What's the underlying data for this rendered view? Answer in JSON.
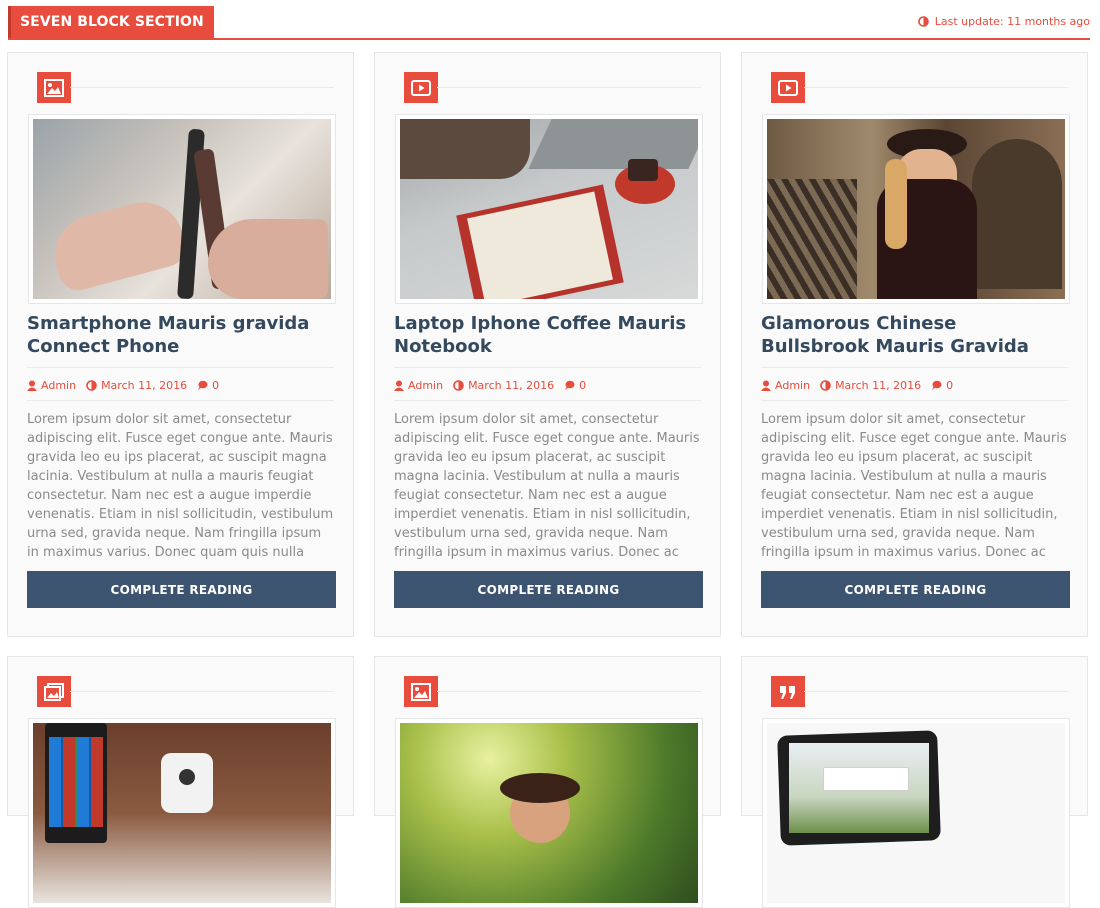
{
  "section": {
    "title": "SEVEN BLOCK SECTION",
    "last_update": "Last update: 11 months ago"
  },
  "colors": {
    "accent": "#e74c3c",
    "button": "#3d5470",
    "title": "#34495e"
  },
  "posts": [
    {
      "format_icon": "image-icon",
      "title": "Smartphone Mauris gravida Connect Phone",
      "author": "Admin",
      "date": "March 11, 2016",
      "comments": "0",
      "excerpt": "Lorem ipsum dolor sit amet, consectetur adipiscing elit.  Fusce eget congue ante.  Mauris gravida leo eu ips placerat, ac suscipit magna lacinia. Vestibulum at nulla a mauris feugiat consectetur. Nam nec est a augue imperdie venenatis. Etiam in nisl sollicitudin, vestibulum urna sed, gravida neque. Nam fringilla ipsum in maximus varius. Donec  quam quis nulla",
      "button": "COMPLETE READING"
    },
    {
      "format_icon": "video-icon",
      "title": "Laptop Iphone Coffee Mauris Notebook",
      "author": "Admin",
      "date": "March 11, 2016",
      "comments": "0",
      "excerpt": "Lorem ipsum dolor sit amet, consectetur adipiscing elit. Fusce eget congue ante. Mauris gravida leo eu ipsum placerat, ac suscipit magna lacinia. Vestibulum at nulla a mauris feugiat consectetur. Nam nec est a augue imperdiet venenatis. Etiam in nisl sollicitudin, vestibulum urna sed, gravida neque. Nam fringilla ipsum in maximus varius. Donec ac quam quis",
      "button": "COMPLETE READING"
    },
    {
      "format_icon": "video-icon",
      "title": "Glamorous Chinese Bullsbrook Mauris Gravida",
      "author": "Admin",
      "date": "March 11, 2016",
      "comments": "0",
      "excerpt": "Lorem ipsum dolor sit amet, consectetur adipiscing elit. Fusce eget congue ante. Mauris gravida leo eu ipsum placerat, ac suscipit magna lacinia. Vestibulum at nulla a mauris feugiat consectetur. Nam nec est a augue imperdiet venenatis. Etiam in nisl sollicitudin, vestibulum urna sed, gravida neque. Nam fringilla ipsum in maximus varius. Donec ac quam quis",
      "button": "COMPLETE READING"
    },
    {
      "format_icon": "gallery-icon"
    },
    {
      "format_icon": "image-icon"
    },
    {
      "format_icon": "quote-icon"
    }
  ]
}
